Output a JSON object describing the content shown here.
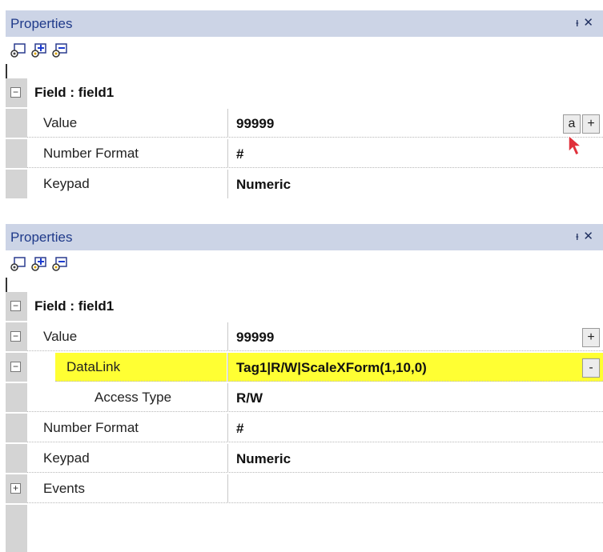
{
  "panel1": {
    "title": "Properties",
    "pin_icon": "pin-icon",
    "close_label": "✕",
    "category": "Field : field1",
    "rows": [
      {
        "name": "Value",
        "value": "99999"
      },
      {
        "name": "Number Format",
        "value": "#"
      },
      {
        "name": "Keypad",
        "value": "Numeric"
      }
    ],
    "button_a": "a",
    "button_plus": "+"
  },
  "panel2": {
    "title": "Properties",
    "close_label": "✕",
    "category": "Field : field1",
    "rows": [
      {
        "name": "Value",
        "value": "99999"
      },
      {
        "name": "DataLink",
        "value": "Tag1|R/W|ScaleXForm(1,10,0)"
      },
      {
        "name": "Access Type",
        "value": "R/W"
      },
      {
        "name": "Number Format",
        "value": "#"
      },
      {
        "name": "Keypad",
        "value": "Numeric"
      },
      {
        "name": "Events",
        "value": ""
      }
    ],
    "button_plus": "+",
    "button_minus": "-"
  },
  "colors": {
    "title_bar": "#ccd4e6",
    "highlight": "#ffff33",
    "gutter": "#d4d4d4"
  }
}
